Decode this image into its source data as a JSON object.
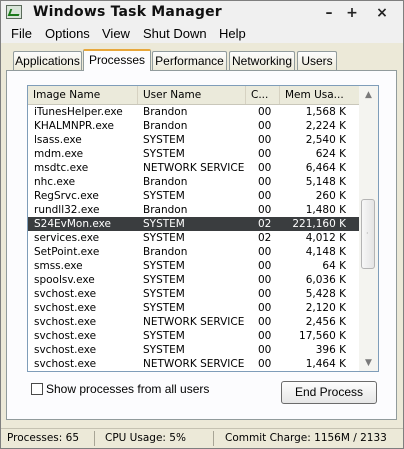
{
  "window": {
    "title": "Windows Task Manager",
    "controls": {
      "minimize": "–",
      "maximize": "+",
      "close": "×"
    }
  },
  "menu": [
    "File",
    "Options",
    "View",
    "Shut Down",
    "Help"
  ],
  "tabs": [
    {
      "label": "Applications",
      "active": false
    },
    {
      "label": "Processes",
      "active": true
    },
    {
      "label": "Performance",
      "active": false
    },
    {
      "label": "Networking",
      "active": false
    },
    {
      "label": "Users",
      "active": false
    }
  ],
  "processes": {
    "columns": [
      "Image Name",
      "User Name",
      "C...",
      "Mem Usa..."
    ],
    "rows": [
      {
        "name": "iTunesHelper.exe",
        "user": "Brandon",
        "cpu": "00",
        "mem": "1,568 K"
      },
      {
        "name": "KHALMNPR.exe",
        "user": "Brandon",
        "cpu": "00",
        "mem": "2,224 K"
      },
      {
        "name": "lsass.exe",
        "user": "SYSTEM",
        "cpu": "00",
        "mem": "2,540 K"
      },
      {
        "name": "mdm.exe",
        "user": "SYSTEM",
        "cpu": "00",
        "mem": "624 K"
      },
      {
        "name": "msdtc.exe",
        "user": "NETWORK SERVICE",
        "cpu": "00",
        "mem": "6,464 K"
      },
      {
        "name": "nhc.exe",
        "user": "Brandon",
        "cpu": "00",
        "mem": "5,148 K"
      },
      {
        "name": "RegSrvc.exe",
        "user": "SYSTEM",
        "cpu": "00",
        "mem": "260 K"
      },
      {
        "name": "rundll32.exe",
        "user": "Brandon",
        "cpu": "00",
        "mem": "1,480 K"
      },
      {
        "name": "S24EvMon.exe",
        "user": "SYSTEM",
        "cpu": "02",
        "mem": "221,160 K",
        "selected": true
      },
      {
        "name": "services.exe",
        "user": "SYSTEM",
        "cpu": "02",
        "mem": "4,012 K"
      },
      {
        "name": "SetPoint.exe",
        "user": "Brandon",
        "cpu": "00",
        "mem": "4,148 K"
      },
      {
        "name": "smss.exe",
        "user": "SYSTEM",
        "cpu": "00",
        "mem": "64 K"
      },
      {
        "name": "spoolsv.exe",
        "user": "SYSTEM",
        "cpu": "00",
        "mem": "6,036 K"
      },
      {
        "name": "svchost.exe",
        "user": "SYSTEM",
        "cpu": "00",
        "mem": "5,428 K"
      },
      {
        "name": "svchost.exe",
        "user": "SYSTEM",
        "cpu": "00",
        "mem": "2,120 K"
      },
      {
        "name": "svchost.exe",
        "user": "NETWORK SERVICE",
        "cpu": "00",
        "mem": "2,456 K"
      },
      {
        "name": "svchost.exe",
        "user": "SYSTEM",
        "cpu": "00",
        "mem": "17,560 K"
      },
      {
        "name": "svchost.exe",
        "user": "SYSTEM",
        "cpu": "00",
        "mem": "396 K"
      },
      {
        "name": "svchost.exe",
        "user": "NETWORK SERVICE",
        "cpu": "00",
        "mem": "1,464 K"
      }
    ]
  },
  "show_all_users": {
    "label": "Show processes from all users",
    "checked": false
  },
  "end_process_label": "End Process",
  "status": {
    "processes": "Processes: 65",
    "cpu": "CPU Usage: 5%",
    "commit": "Commit Charge: 1156M / 2133"
  }
}
